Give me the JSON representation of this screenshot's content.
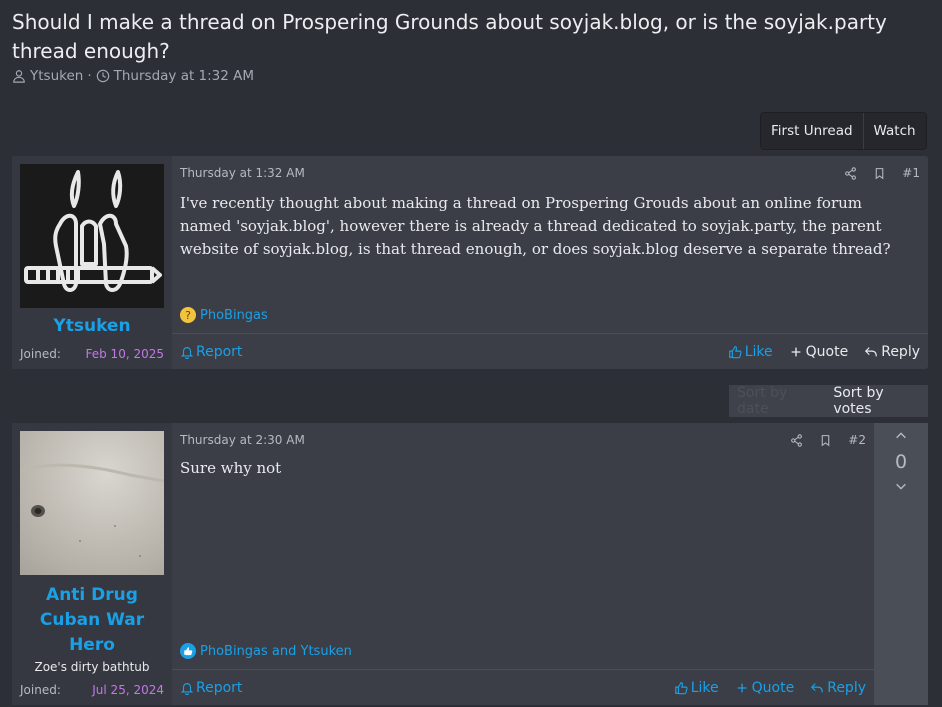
{
  "thread": {
    "title": "Should I make a thread on Prospering Grounds about soyjak.blog, or is the soyjak.party thread enough?",
    "author": "Ytsuken",
    "separator": "·",
    "date": "Thursday at 1:32 AM"
  },
  "actions": {
    "first_unread": "First Unread",
    "watch": "Watch"
  },
  "sort": {
    "by_date": "Sort by date",
    "by_votes": "Sort by votes"
  },
  "posts": [
    {
      "username": "Ytsuken",
      "joined_label": "Joined:",
      "joined_date": "Feb 10, 2025",
      "date": "Thursday at 1:32 AM",
      "number": "#1",
      "text": "I've recently thought about making a thread on Prospering Grouds about an online forum named 'soyjak.blog', however there is already a thread dedicated to soyjak.party, the parent website of soyjak.blog, is that thread enough, or does soyjak.blog deserve a separate thread?",
      "reactions": "PhoBingas",
      "report": "Report",
      "like": "Like",
      "quote": "Quote",
      "reply": "Reply"
    },
    {
      "username": "Anti Drug Cuban War Hero",
      "user_title": "Zoe's dirty bathtub",
      "joined_label": "Joined:",
      "joined_date": "Jul 25, 2024",
      "date": "Thursday at 2:30 AM",
      "number": "#2",
      "text": "Sure why not",
      "reactions": "PhoBingas and Ytsuken",
      "report": "Report",
      "like": "Like",
      "quote": "Quote",
      "reply": "Reply",
      "score": "0"
    }
  ],
  "colors": {
    "accent": "#1aa0e6",
    "joined_date": "#c776e8",
    "background": "#2c2f36"
  }
}
